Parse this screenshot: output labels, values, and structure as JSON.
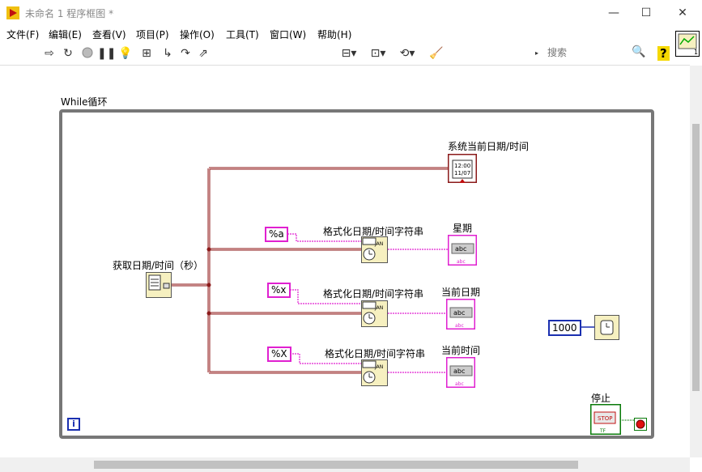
{
  "window": {
    "title": "未命名 1 程序框图 *",
    "minimize": "—",
    "maximize": "☐",
    "close": "✕"
  },
  "menu": [
    "文件(F)",
    "编辑(E)",
    "查看(V)",
    "项目(P)",
    "操作(O)",
    "工具(T)",
    "窗口(W)",
    "帮助(H)"
  ],
  "toolbar": {
    "font": "17pt 应用程序字体",
    "search_placeholder": "搜索",
    "help": "?"
  },
  "diagram": {
    "while_loop_label": "While循环",
    "get_datetime_label": "获取日期/时间（秒）",
    "system_datetime_label": "系统当前日期/时间",
    "format_label_1": "格式化日期/时间字符串",
    "format_label_2": "格式化日期/时间字符串",
    "format_label_3": "格式化日期/时间字符串",
    "const_a": "%a",
    "const_x": "%x",
    "const_X": "%X",
    "weekday_label": "星期",
    "current_date_label": "当前日期",
    "current_time_label": "当前时间",
    "wait_value": "1000",
    "stop_label": "停止",
    "stop_button_text": "STOP",
    "iteration_label": "i",
    "clock_text_1": "12:00",
    "clock_text_2": "11/07",
    "indicator_text": "abc",
    "jan_text": "JAN"
  },
  "colors": {
    "wire_timestamp": "#8b1a1a",
    "wire_string": "#e020d0",
    "wire_numeric": "#1a2fb0",
    "wire_bool": "#0a7a0a",
    "loop_border": "#777777"
  }
}
